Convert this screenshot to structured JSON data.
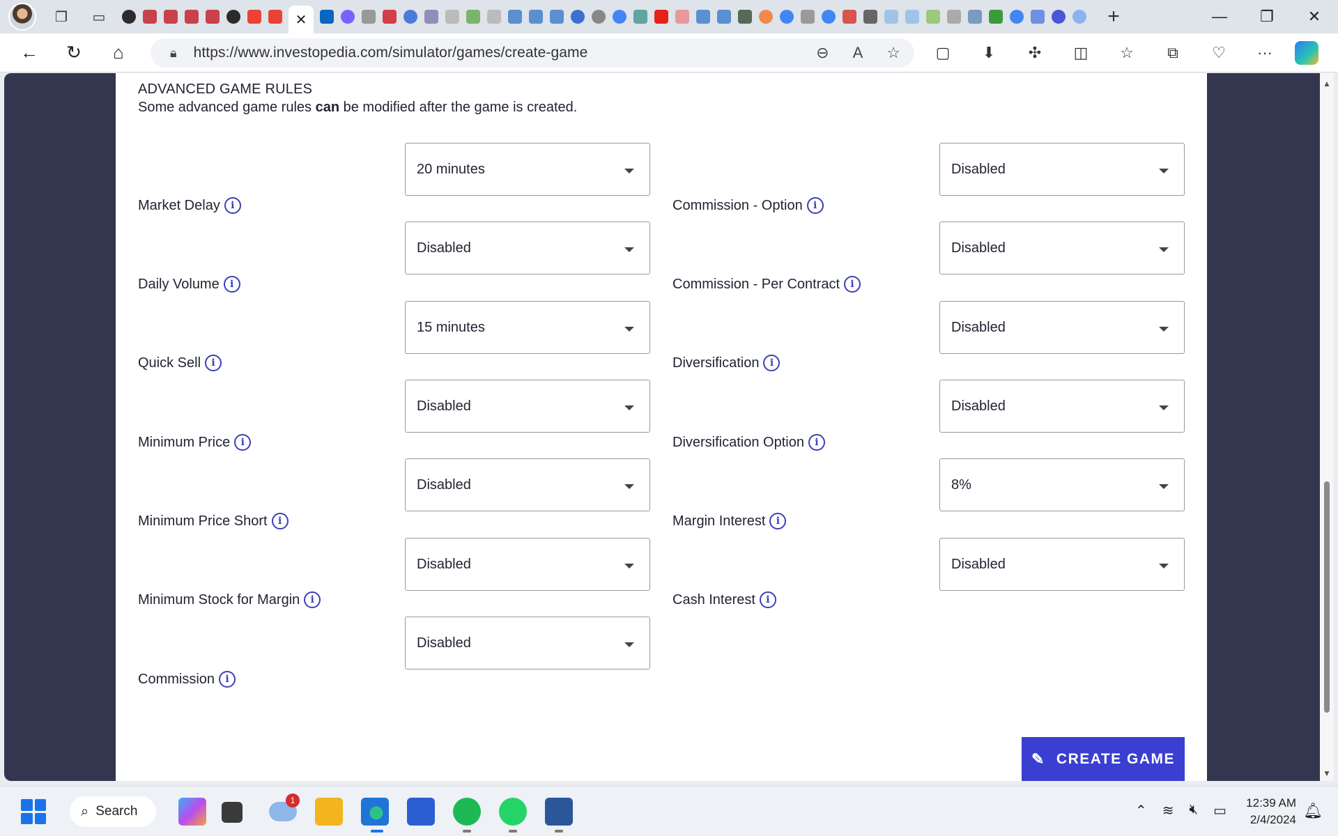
{
  "browser": {
    "url": "https://www.investopedia.com/simulator/games/create-game",
    "active_tab_close": "✕",
    "new_tab": "+"
  },
  "section": {
    "title": "ADVANCED GAME RULES",
    "subtitle_before": "Some advanced game rules ",
    "subtitle_bold": "can",
    "subtitle_after": " be modified after the game is created."
  },
  "rules_left": [
    {
      "label": "Market Delay",
      "value": "20 minutes"
    },
    {
      "label": "Daily Volume",
      "value": "Disabled"
    },
    {
      "label": "Quick Sell",
      "value": "15 minutes"
    },
    {
      "label": "Minimum Price",
      "value": "Disabled"
    },
    {
      "label": "Minimum Price Short",
      "value": "Disabled"
    },
    {
      "label": "Minimum Stock for Margin",
      "value": "Disabled"
    },
    {
      "label": "Commission",
      "value": "Disabled"
    }
  ],
  "rules_right": [
    {
      "label": "Commission - Option",
      "value": "Disabled"
    },
    {
      "label": "Commission - Per Contract",
      "value": "Disabled"
    },
    {
      "label": "Diversification",
      "value": "Disabled"
    },
    {
      "label": "Diversification Option",
      "value": "Disabled"
    },
    {
      "label": "Margin Interest",
      "value": "8%"
    },
    {
      "label": "Cash Interest",
      "value": "Disabled"
    }
  ],
  "create_button": "CREATE GAME",
  "taskbar": {
    "search_label": "Search",
    "notification_count": "1",
    "time": "12:39 AM",
    "date": "2/4/2024"
  },
  "colors": {
    "accent": "#3a3fd1",
    "sidebar": "#34364f",
    "info_icon": "#3b3fb6"
  }
}
